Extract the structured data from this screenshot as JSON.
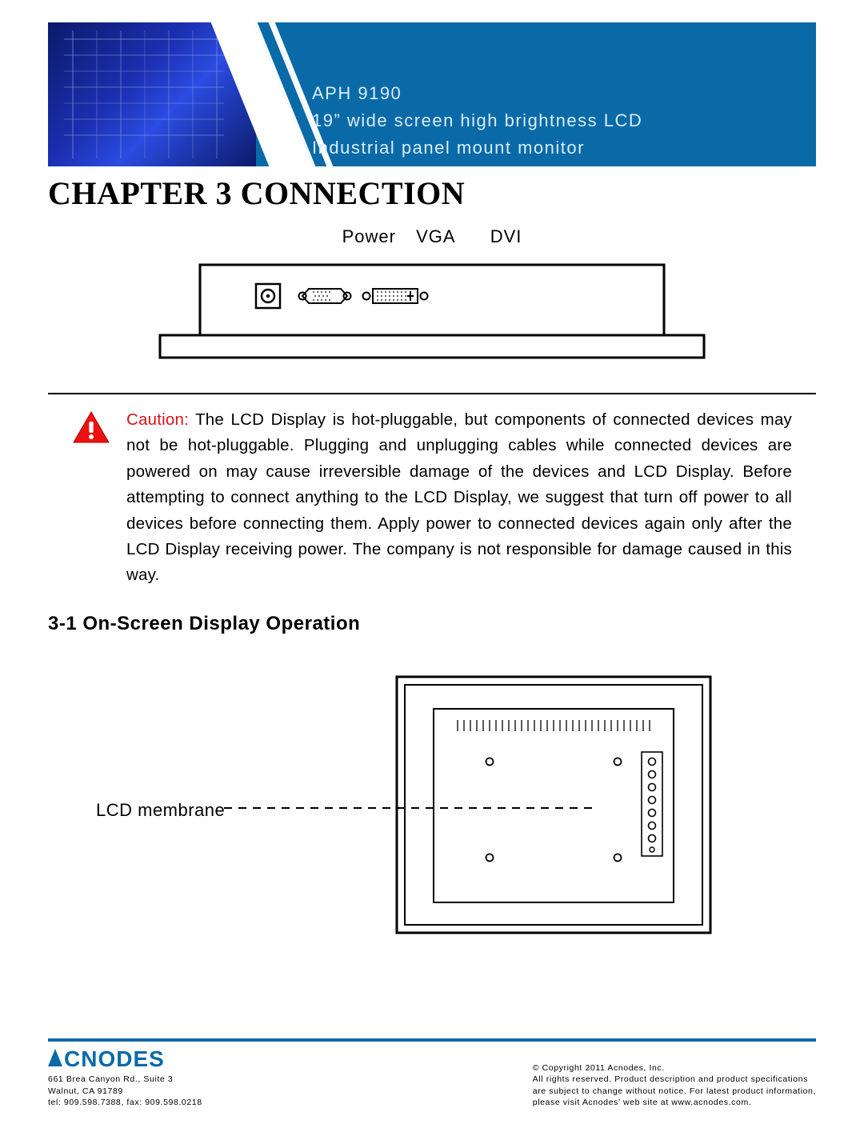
{
  "banner": {
    "line1": "APH 9190",
    "line2": "19” wide screen high brightness LCD",
    "line3": "Industrial panel mount monitor"
  },
  "chapter_title": "CHAPTER 3 CONNECTION",
  "connectors": {
    "power": "Power",
    "vga": "VGA",
    "dvi": "DVI"
  },
  "caution": {
    "lead": "Caution:",
    "body": " The LCD Display is hot-pluggable, but components of connected devices may not be hot-pluggable. Plugging and unplugging cables while connected devices are powered on may cause irreversible damage of the devices and LCD Display. Before attempting to connect anything to the LCD Display, we suggest that turn off power to all devices before connecting them. Apply power to connected devices again only after the LCD Display receiving power. The company is not responsible for damage caused in this way."
  },
  "section_3_1": "3-1  On-Screen Display Operation",
  "osd": {
    "lcd_membrane": "LCD membrane"
  },
  "footer": {
    "logo": "CNODES",
    "addr1": "661 Brea Canyon Rd., Suite 3",
    "addr2": "Walnut, CA 91789",
    "addr3": "tel: 909.598.7388, fax: 909.598.0218",
    "copy1": "© Copyright 2011 Acnodes, Inc.",
    "copy2": "All rights reserved. Product description and product specifications",
    "copy3": "are subject to change without notice. For latest product information,",
    "copy4": "please visit Acnodes’ web site at www.acnodes.com."
  }
}
